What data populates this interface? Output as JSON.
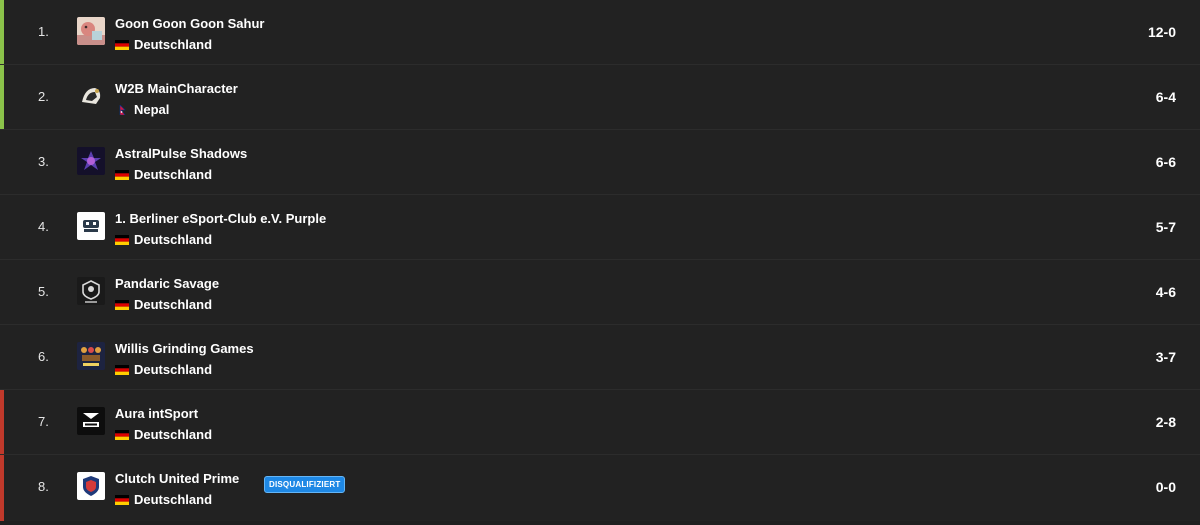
{
  "colors": {
    "promotion": "#8bc34a",
    "relegation": "#c0392b",
    "badge": "#1e88e5"
  },
  "rows": [
    {
      "rank": "1.",
      "team": "Goon Goon Goon Sahur",
      "country": "Deutschland",
      "flag": "de",
      "score": "12-0",
      "zone": "promo",
      "logo": "cartoon-avatar"
    },
    {
      "rank": "2.",
      "team": "W2B MainCharacter",
      "country": "Nepal",
      "flag": "np",
      "score": "6-4",
      "zone": "promo",
      "logo": "helmet-logo"
    },
    {
      "rank": "3.",
      "team": "AstralPulse Shadows",
      "country": "Deutschland",
      "flag": "de",
      "score": "6-6",
      "zone": "none",
      "logo": "astral-logo"
    },
    {
      "rank": "4.",
      "team": "1. Berliner eSport-Club e.V. Purple",
      "country": "Deutschland",
      "flag": "de",
      "score": "5-7",
      "zone": "none",
      "logo": "berliner-logo"
    },
    {
      "rank": "5.",
      "team": "Pandaric Savage",
      "country": "Deutschland",
      "flag": "de",
      "score": "4-6",
      "zone": "none",
      "logo": "svg-shield-logo"
    },
    {
      "rank": "6.",
      "team": "Willis Grinding Games",
      "country": "Deutschland",
      "flag": "de",
      "score": "3-7",
      "zone": "none",
      "logo": "willis-logo"
    },
    {
      "rank": "7.",
      "team": "Aura intSport",
      "country": "Deutschland",
      "flag": "de",
      "score": "2-8",
      "zone": "releg",
      "logo": "aura-logo"
    },
    {
      "rank": "8.",
      "team": "Clutch United Prime",
      "country": "Deutschland",
      "flag": "de",
      "score": "0-0",
      "zone": "releg",
      "logo": "clutch-logo",
      "badge": "DISQUALIFIZIERT"
    }
  ]
}
